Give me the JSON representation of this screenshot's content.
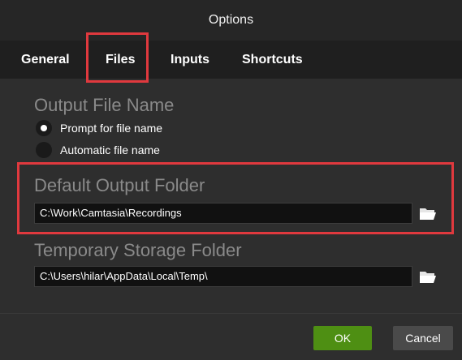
{
  "window": {
    "title": "Options"
  },
  "tabs": [
    {
      "label": "General"
    },
    {
      "label": "Files"
    },
    {
      "label": "Inputs"
    },
    {
      "label": "Shortcuts"
    }
  ],
  "selected_tab": "Files",
  "output_file_name": {
    "heading": "Output File Name",
    "options": [
      {
        "label": "Prompt for file name",
        "checked": true
      },
      {
        "label": "Automatic file name",
        "checked": false
      }
    ]
  },
  "default_output_folder": {
    "heading": "Default Output Folder",
    "path": "C:\\Work\\Camtasia\\Recordings",
    "browse_icon": "folder-icon"
  },
  "temporary_storage_folder": {
    "heading": "Temporary Storage Folder",
    "path": "C:\\Users\\hilar\\AppData\\Local\\Temp\\",
    "browse_icon": "folder-icon"
  },
  "buttons": {
    "ok": "OK",
    "cancel": "Cancel"
  },
  "colors": {
    "highlight": "#e0393e",
    "ok_button": "#4e8f13",
    "background": "#2e2e2e"
  }
}
